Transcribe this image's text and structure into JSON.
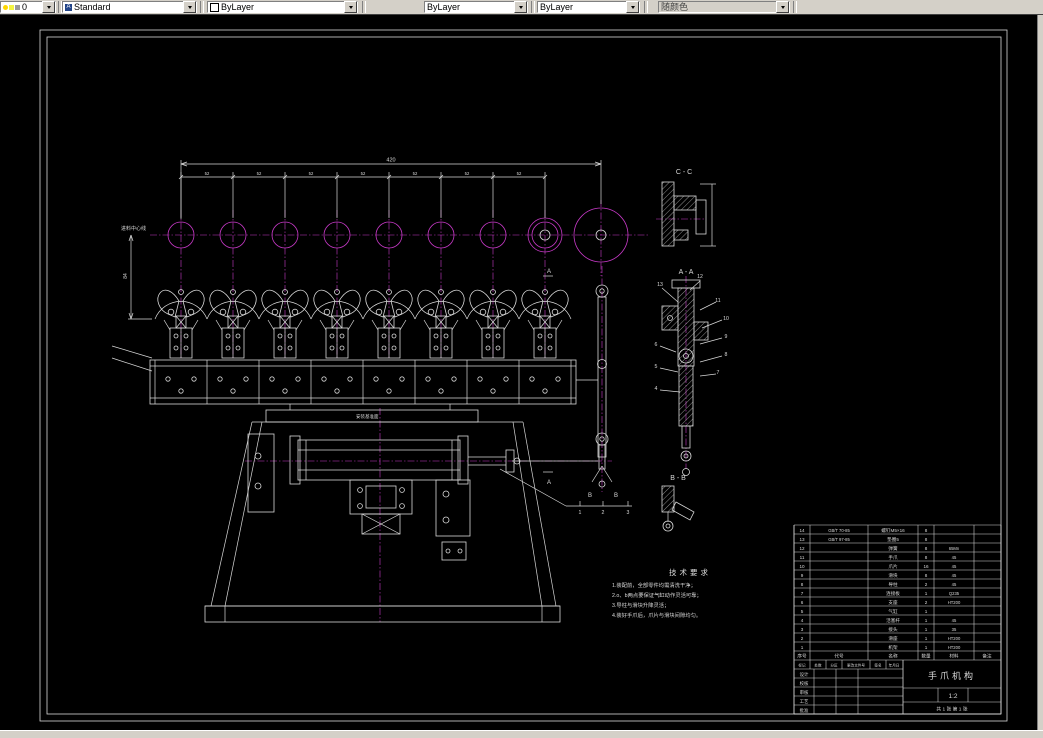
{
  "toolbar": {
    "layer": {
      "value": "0"
    },
    "style": {
      "icon": "A",
      "value": "Standard"
    },
    "color": {
      "value": "ByLayer"
    },
    "linetype": {
      "value": "ByLayer"
    },
    "lineweight": {
      "value": "ByLayer"
    },
    "plot_style": {
      "value": "随颜色"
    }
  },
  "drawing": {
    "sections": {
      "cc": "C - C",
      "aa": "A - A",
      "bb": "B - B"
    },
    "section_letters": {
      "a": "A",
      "b": "B"
    },
    "labels": {
      "feed_centerline": "进料中心线",
      "datum": "安装基准面"
    },
    "dimensions": {
      "overall": "420",
      "pitch": "52",
      "height": "84"
    },
    "tech_requirements": {
      "title": "技术要求",
      "items": [
        "1.装配前，全部零件均需清洗干净；",
        "2.o、b两点要保证气缸动作灵活可靠；",
        "3.导柱与滑块升降灵活；",
        "4.装好手爪后，爪片与滑块间隙均匀。"
      ]
    },
    "callouts": [
      "1",
      "2",
      "3",
      "4",
      "5",
      "6",
      "7",
      "8",
      "9",
      "10",
      "11",
      "12",
      "13"
    ]
  },
  "title_block": {
    "title": "手爪机构",
    "scale": "1:2",
    "sheet": "共 1 张  第 1 张",
    "revision_headers": [
      "标记",
      "处数",
      "分区",
      "更改文件号",
      "签名",
      "年月日"
    ],
    "signature_rows": [
      "设计",
      "校核",
      "审核",
      "工艺",
      "批准"
    ],
    "parts_header": [
      "序号",
      "代号",
      "名称",
      "数量",
      "材料",
      "备注"
    ],
    "parts": [
      {
        "seq": "14",
        "code": "GB/T 70-85",
        "name": "螺钉M5×16",
        "qty": "8",
        "mat": "",
        "note": ""
      },
      {
        "seq": "13",
        "code": "GB/T 97-85",
        "name": "垫圈5",
        "qty": "8",
        "mat": "",
        "note": ""
      },
      {
        "seq": "12",
        "code": "",
        "name": "弹簧",
        "qty": "8",
        "mat": "65Mn",
        "note": ""
      },
      {
        "seq": "11",
        "code": "",
        "name": "手爪",
        "qty": "8",
        "mat": "45",
        "note": ""
      },
      {
        "seq": "10",
        "code": "",
        "name": "爪片",
        "qty": "16",
        "mat": "45",
        "note": ""
      },
      {
        "seq": "9",
        "code": "",
        "name": "滑块",
        "qty": "8",
        "mat": "45",
        "note": ""
      },
      {
        "seq": "8",
        "code": "",
        "name": "导柱",
        "qty": "2",
        "mat": "45",
        "note": ""
      },
      {
        "seq": "7",
        "code": "",
        "name": "连接板",
        "qty": "1",
        "mat": "Q235",
        "note": ""
      },
      {
        "seq": "6",
        "code": "",
        "name": "支座",
        "qty": "2",
        "mat": "HT200",
        "note": ""
      },
      {
        "seq": "5",
        "code": "",
        "name": "气缸",
        "qty": "1",
        "mat": "",
        "note": ""
      },
      {
        "seq": "4",
        "code": "",
        "name": "活塞杆",
        "qty": "1",
        "mat": "45",
        "note": ""
      },
      {
        "seq": "3",
        "code": "",
        "name": "接头",
        "qty": "1",
        "mat": "35",
        "note": ""
      },
      {
        "seq": "2",
        "code": "",
        "name": "滑座",
        "qty": "1",
        "mat": "HT200",
        "note": ""
      },
      {
        "seq": "1",
        "code": "",
        "name": "机架",
        "qty": "1",
        "mat": "HT200",
        "note": ""
      }
    ]
  },
  "colors": {
    "accent_magenta": "#c93ac9",
    "line_white": "#d9d9d9",
    "toolbar_bg": "#d4d0c8"
  }
}
